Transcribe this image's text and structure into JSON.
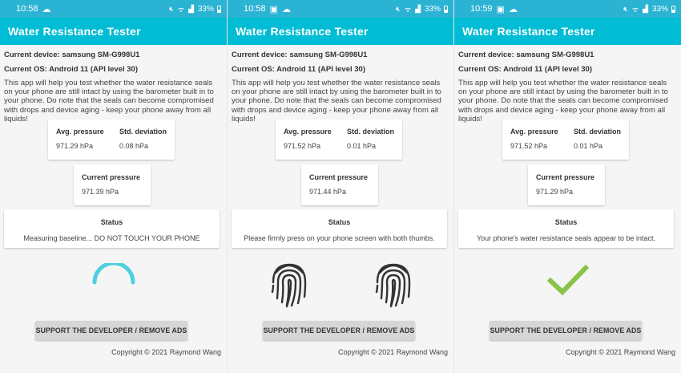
{
  "screens": [
    {
      "statusbar": {
        "time": "10:58",
        "icons": [
          "cloud-icon"
        ],
        "battery": "33%"
      },
      "app_title": "Water Resistance Tester",
      "device": "Current device: samsung SM-G998U1",
      "os": "Current OS: Android 11 (API level 30)",
      "description": "This app will help you test whether the water resistance seals on your phone are still intact by using the barometer built in to your phone. Do note that the seals can become compromised with drops and device aging - keep your phone away from all liquids!",
      "avg_label": "Avg. pressure",
      "avg_value": "971.29 hPa",
      "std_label": "Std. deviation",
      "std_value": "0.08 hPa",
      "current_label": "Current pressure",
      "current_value": "971.39 hPa",
      "status_label": "Status",
      "status_text": "Measuring baseline... DO NOT TOUCH YOUR PHONE",
      "indicator": "loading-spinner",
      "support_button": "SUPPORT THE DEVELOPER / REMOVE ADS",
      "copyright": "Copyright © 2021 Raymond Wang"
    },
    {
      "statusbar": {
        "time": "10:58",
        "icons": [
          "image-icon",
          "cloud-icon"
        ],
        "battery": "33%"
      },
      "app_title": "Water Resistance Tester",
      "device": "Current device: samsung SM-G998U1",
      "os": "Current OS: Android 11 (API level 30)",
      "description": "This app will help you test whether the water resistance seals on your phone are still intact by using the barometer built in to your phone. Do note that the seals can become compromised with drops and device aging - keep your phone away from all liquids!",
      "avg_label": "Avg. pressure",
      "avg_value": "971.52 hPa",
      "std_label": "Std. deviation",
      "std_value": "0.01 hPa",
      "current_label": "Current pressure",
      "current_value": "971.44 hPa",
      "status_label": "Status",
      "status_text": "Please firmly press on your phone screen with both thumbs.",
      "indicator": "fingerprints",
      "support_button": "SUPPORT THE DEVELOPER / REMOVE ADS",
      "copyright": "Copyright © 2021 Raymond Wang"
    },
    {
      "statusbar": {
        "time": "10:59",
        "icons": [
          "image-icon",
          "cloud-icon"
        ],
        "battery": "33%"
      },
      "app_title": "Water Resistance Tester",
      "device": "Current device: samsung SM-G998U1",
      "os": "Current OS: Android 11 (API level 30)",
      "description": "This app will help you test whether the water resistance seals on your phone are still intact by using the barometer built in to your phone. Do note that the seals can become compromised with drops and device aging - keep your phone away from all liquids!",
      "avg_label": "Avg. pressure",
      "avg_value": "971.52 hPa",
      "std_label": "Std. deviation",
      "std_value": "0.01 hPa",
      "current_label": "Current pressure",
      "current_value": "971.29 hPa",
      "status_label": "Status",
      "status_text": "Your phone's water resistance seals appear to be intact.",
      "indicator": "success-checkmark",
      "support_button": "SUPPORT THE DEVELOPER / REMOVE ADS",
      "copyright": "Copyright © 2021 Raymond Wang"
    }
  ],
  "colors": {
    "statusbar": "#2bb3d3",
    "appbar": "#00bcd4",
    "spinner": "#4dd0e1",
    "checkmark": "#8bc34a",
    "fingerprint": "#333333"
  }
}
